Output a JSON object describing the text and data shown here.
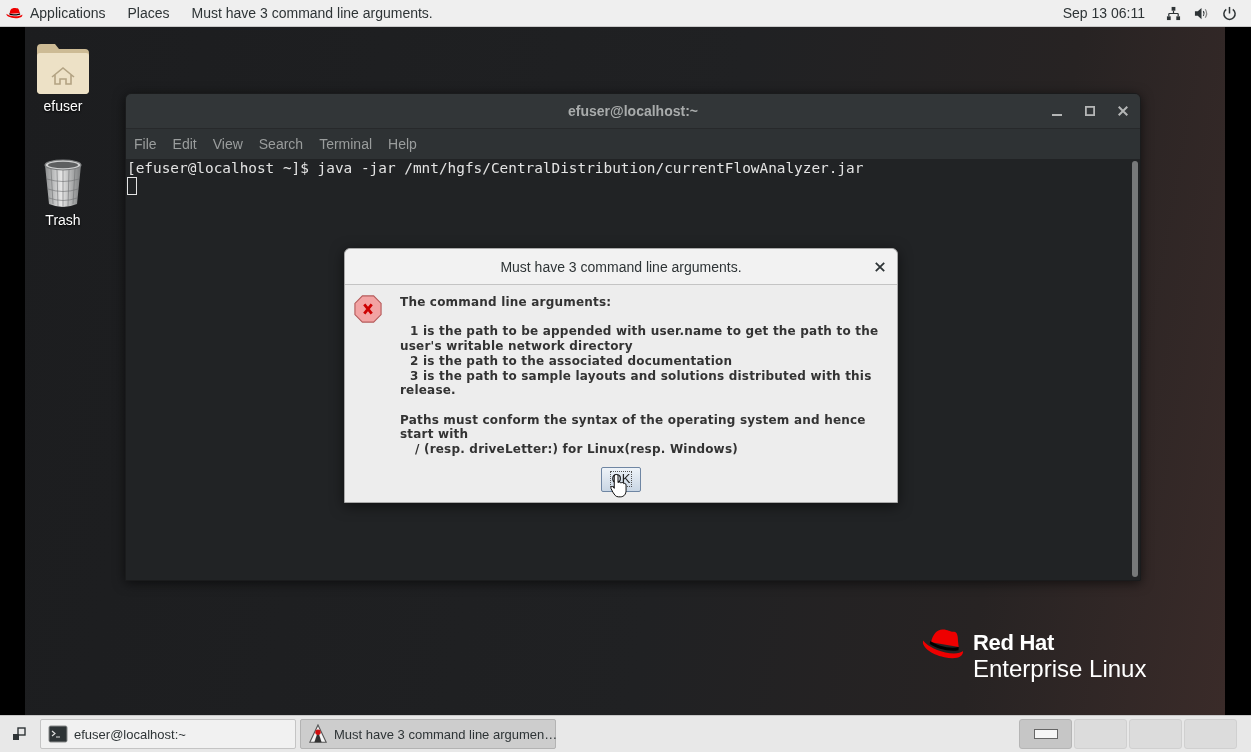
{
  "top_bar": {
    "menus": [
      {
        "kind": "applications",
        "label": "Applications"
      },
      {
        "kind": "places",
        "label": "Places"
      }
    ],
    "app_menu": "Must have 3 command line arguments.",
    "clock": "Sep 13 06:11"
  },
  "desktop_icons": [
    {
      "kind": "folder",
      "label": "efuser"
    },
    {
      "kind": "trash",
      "label": "Trash"
    }
  ],
  "terminal": {
    "title": "efuser@localhost:~",
    "menu": [
      "File",
      "Edit",
      "View",
      "Search",
      "Terminal",
      "Help"
    ],
    "lines": [
      "[efuser@localhost ~]$ java -jar /mnt/hgfs/CentralDistribution/currentFlowAnalyzer.jar"
    ]
  },
  "dialog": {
    "title": "Must have 3 command line arguments.",
    "paragraphs": [
      {
        "lines": [
          {
            "kind": "plain",
            "text": "The command line arguments:"
          }
        ]
      },
      {
        "lines": [
          {
            "kind": "item",
            "text": "1 is the path to be appended with user.name to get the path to the"
          },
          {
            "kind": "plain",
            "text": "user's writable network directory"
          },
          {
            "kind": "item",
            "text": "2 is the path to the associated documentation"
          },
          {
            "kind": "item",
            "text": "3 is the path to sample layouts and solutions distributed with this"
          },
          {
            "kind": "plain",
            "text": "release."
          }
        ]
      },
      {
        "lines": [
          {
            "kind": "plain",
            "text": "Paths must conform the syntax of the operating system and hence"
          },
          {
            "kind": "plain",
            "text": "start with"
          },
          {
            "kind": "path",
            "text": "/ (resp. driveLetter:) for Linux(resp. Windows)"
          }
        ]
      }
    ],
    "button": "OK"
  },
  "taskbar": {
    "tasks": [
      {
        "kind": "terminal",
        "label": "efuser@localhost:~",
        "selected": false
      },
      {
        "kind": "app",
        "label": "Must have 3 command line argumen…",
        "selected": true
      }
    ],
    "workspaces": [
      {
        "selected": true,
        "has_window": true
      },
      {
        "selected": false,
        "has_window": false
      },
      {
        "selected": false,
        "has_window": false
      },
      {
        "selected": false,
        "has_window": false
      }
    ]
  },
  "branding": {
    "name": "Red Hat",
    "product": "Enterprise Linux"
  }
}
